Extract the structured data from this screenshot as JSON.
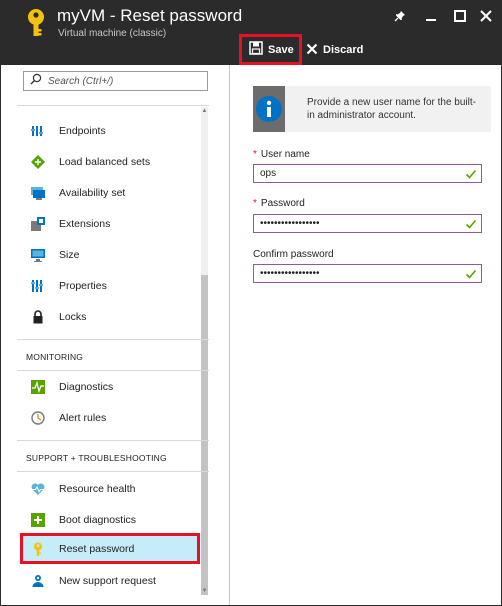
{
  "header": {
    "title": "myVM - Reset password",
    "subtitle": "Virtual machine (classic)",
    "save_label": "Save",
    "discard_label": "Discard"
  },
  "search": {
    "placeholder": "Search (Ctrl+/)"
  },
  "menu": {
    "items": [
      {
        "label": "Endpoints",
        "icon": "endpoints-icon"
      },
      {
        "label": "Load balanced sets",
        "icon": "load-balancer-icon"
      },
      {
        "label": "Availability set",
        "icon": "availability-set-icon"
      },
      {
        "label": "Extensions",
        "icon": "extensions-icon"
      },
      {
        "label": "Size",
        "icon": "size-icon"
      },
      {
        "label": "Properties",
        "icon": "properties-icon"
      },
      {
        "label": "Locks",
        "icon": "lock-icon"
      }
    ],
    "monitoring_heading": "MONITORING",
    "monitoring_items": [
      {
        "label": "Diagnostics",
        "icon": "diagnostics-icon"
      },
      {
        "label": "Alert rules",
        "icon": "alert-rules-icon"
      }
    ],
    "support_heading": "SUPPORT + TROUBLESHOOTING",
    "support_items": [
      {
        "label": "Resource health",
        "icon": "heart-icon"
      },
      {
        "label": "Boot diagnostics",
        "icon": "boot-diagnostics-icon"
      },
      {
        "label": "Reset password",
        "icon": "key-icon",
        "active": true
      },
      {
        "label": "New support request",
        "icon": "support-icon"
      }
    ]
  },
  "form": {
    "info_text": "Provide a new user name for the built-in administrator account.",
    "username_label": "User name",
    "username_value": "ops",
    "password_label": "Password",
    "password_value": "•••••••••••••••••",
    "confirm_label": "Confirm password",
    "confirm_value": "•••••••••••••••••"
  },
  "colors": {
    "header_bg": "#2b2b2b",
    "highlight": "#e81123",
    "active_item_bg": "#c7ecf9",
    "field_border": "#8e5b9c",
    "valid_check": "#57a300",
    "key_yellow": "#f4c20d"
  }
}
